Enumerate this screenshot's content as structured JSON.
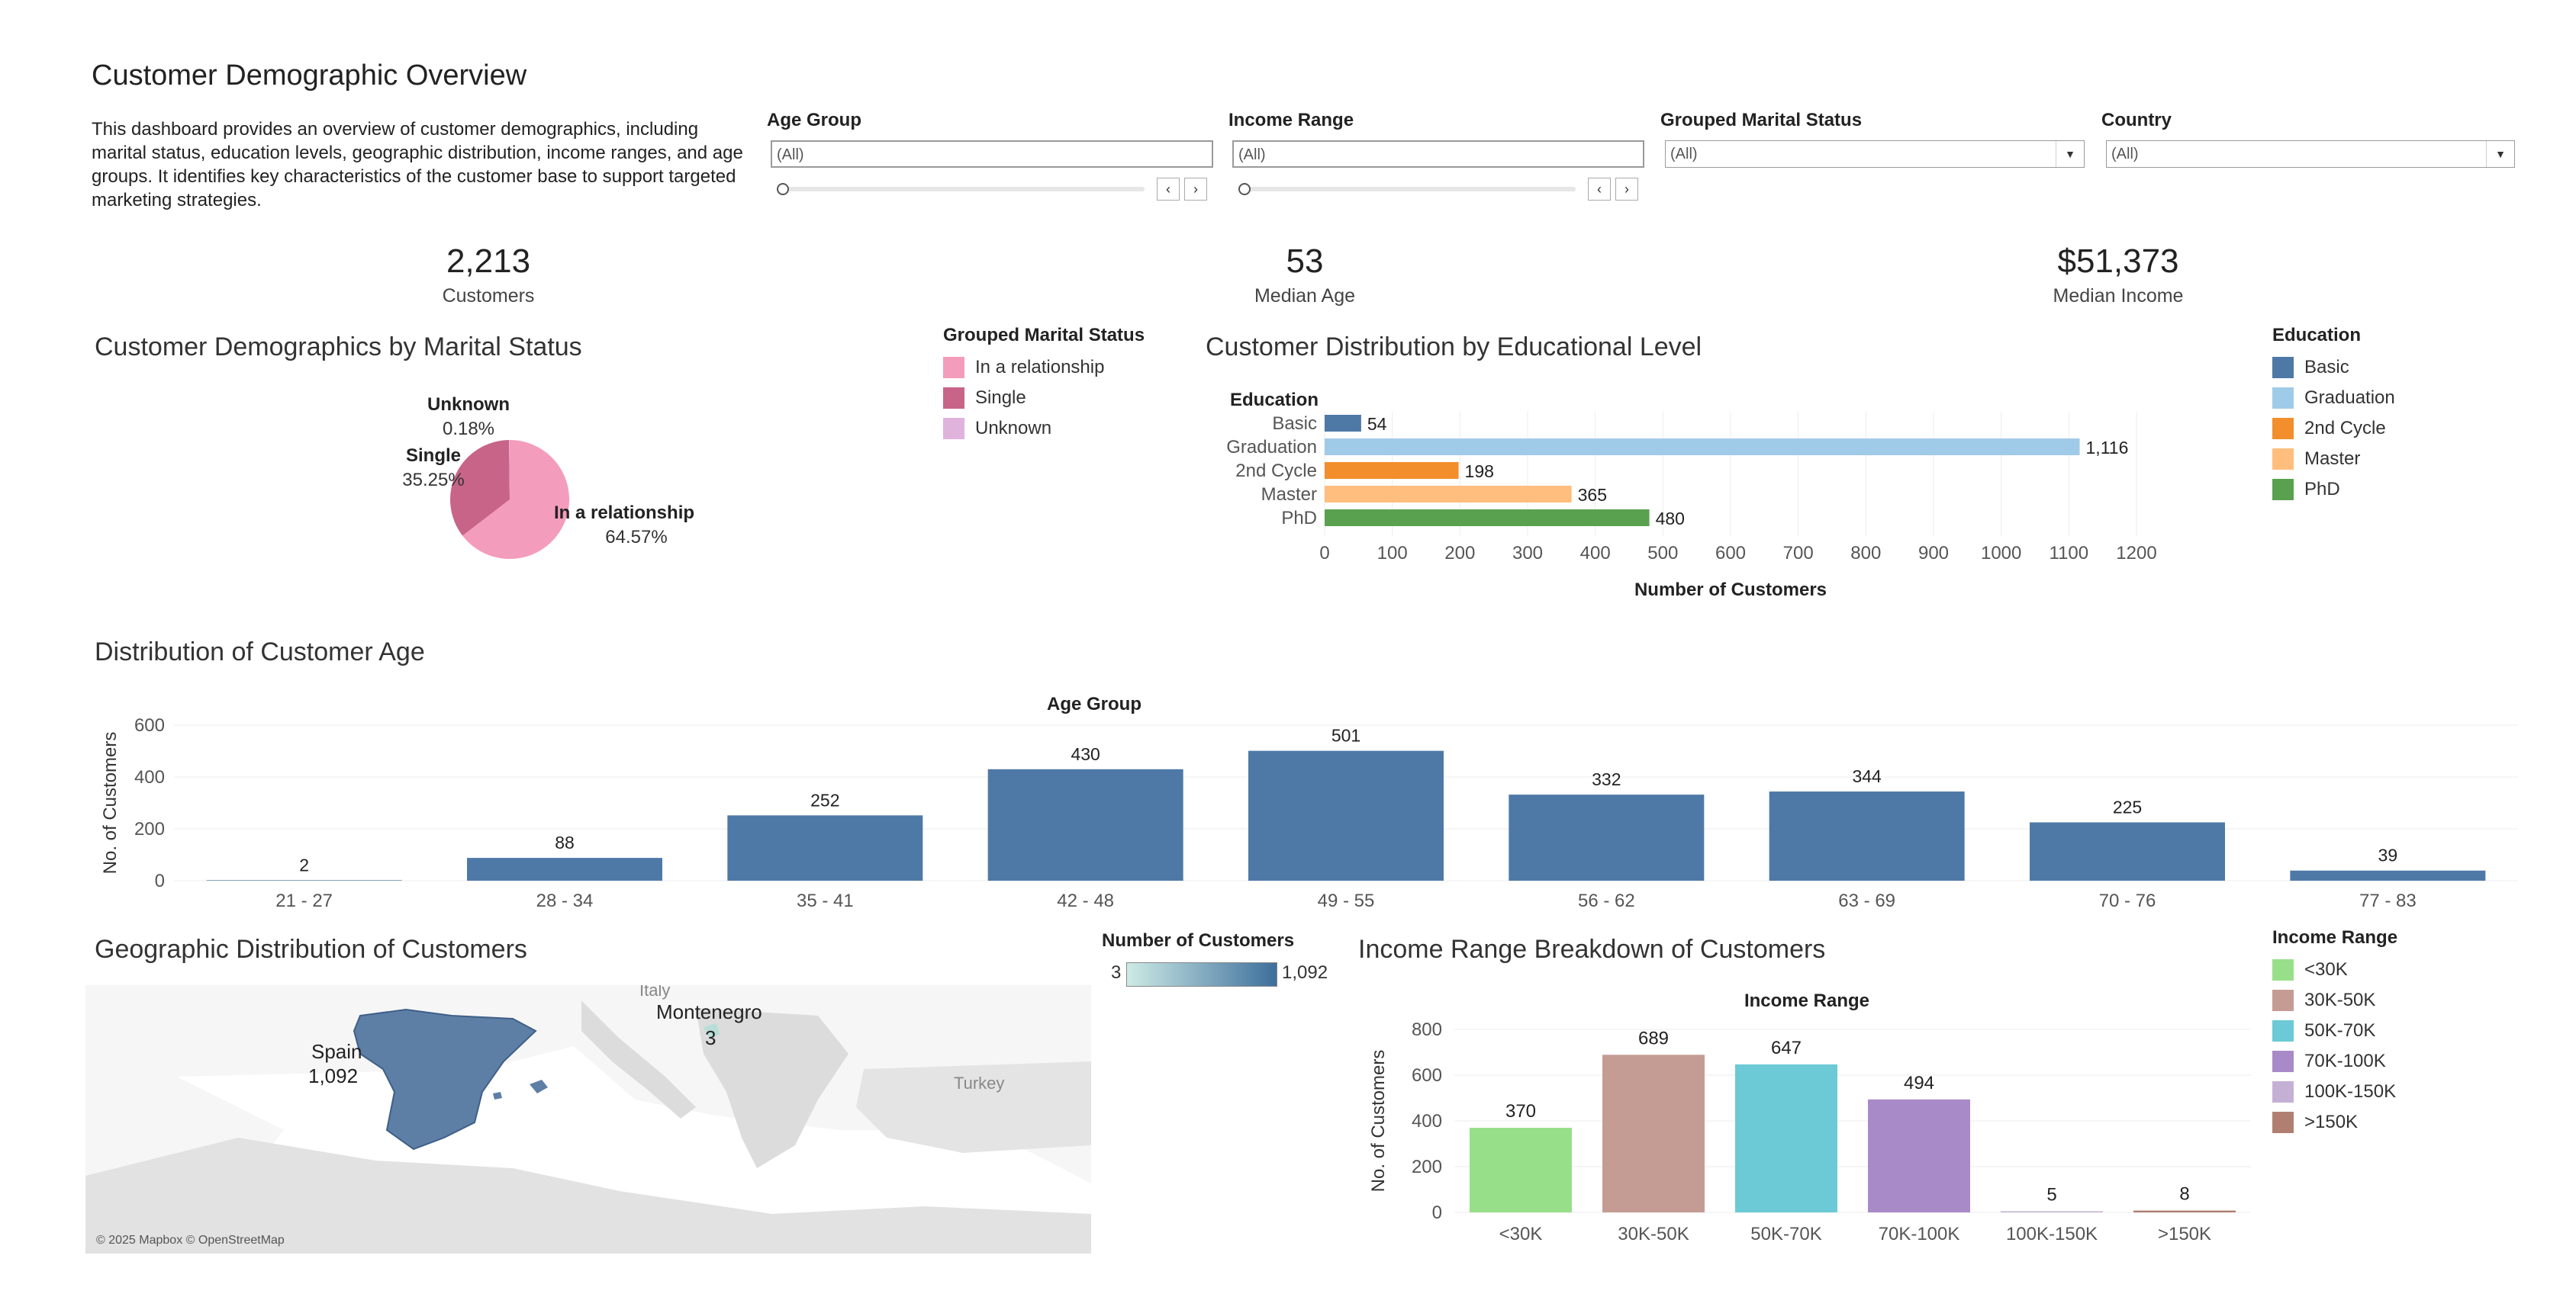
{
  "title": "Customer Demographic Overview",
  "description": "This dashboard provides an overview of customer demographics, including marital status, education levels, geographic distribution, income ranges, and age groups. It identifies key characteristics of the customer base to support targeted marketing strategies.",
  "filters": {
    "age_group": {
      "label": "Age Group",
      "value": "(All)"
    },
    "income_range": {
      "label": "Income Range",
      "value": "(All)"
    },
    "marital_status": {
      "label": "Grouped Marital Status",
      "value": "(All)"
    },
    "country": {
      "label": "Country",
      "value": "(All)"
    }
  },
  "kpis": [
    {
      "value": "2,213",
      "label": "Customers"
    },
    {
      "value": "53",
      "label": "Median Age"
    },
    {
      "value": "$51,373",
      "label": "Median Income"
    }
  ],
  "colors": {
    "steel_blue": "#4e79a7",
    "relationship": "#f49cbb",
    "single": "#c86488",
    "unknown": "#e0b3dc",
    "basic": "#4e79a7",
    "graduation": "#a0cbe8",
    "second_cycle": "#f28e2b",
    "master": "#ffbe7d",
    "phd": "#59a14f",
    "lt30k": "#98df8a",
    "k30_50": "#c49c94",
    "k50_70": "#6bcad6",
    "k70_100": "#a98ac8",
    "k100_150": "#c5b0d5",
    "gt150k": "#b07f72"
  },
  "marital": {
    "title": "Customer Demographics by Marital Status",
    "legend_title": "Grouped Marital Status",
    "legend": [
      "In a relationship",
      "Single",
      "Unknown"
    ]
  },
  "education": {
    "title": "Customer Distribution by Educational Level",
    "legend_title": "Education",
    "legend": [
      "Basic",
      "Graduation",
      "2nd Cycle",
      "Master",
      "PhD"
    ]
  },
  "age": {
    "title": "Distribution of Customer Age"
  },
  "geo": {
    "title": "Geographic Distribution of Customers",
    "legend_title": "Number of Customers",
    "legend_min": "3",
    "legend_max": "1,092",
    "labels": {
      "spain": "Spain",
      "spain_value": "1,092",
      "montenegro": "Montenegro",
      "montenegro_value": "3",
      "italy": "Italy",
      "turkey": "Turkey"
    },
    "attribution": "© 2025 Mapbox © OpenStreetMap"
  },
  "income": {
    "title": "Income Range Breakdown of Customers",
    "legend_title": "Income Range",
    "legend": [
      "<30K",
      "30K-50K",
      "50K-70K",
      "70K-100K",
      "100K-150K",
      ">150K"
    ]
  },
  "chart_data": [
    {
      "type": "pie",
      "categories": [
        "In a relationship",
        "Single",
        "Unknown"
      ],
      "values": [
        64.57,
        35.25,
        0.18
      ],
      "labels": [
        "64.57%",
        "35.25%",
        "0.18%"
      ]
    },
    {
      "type": "bar",
      "orientation": "horizontal",
      "categories": [
        "Basic",
        "Graduation",
        "2nd Cycle",
        "Master",
        "PhD"
      ],
      "values": [
        54,
        1116,
        198,
        365,
        480
      ],
      "value_labels": [
        "54",
        "1,116",
        "198",
        "365",
        "480"
      ],
      "ylabel": "Education",
      "xlabel": "Number of Customers",
      "xlim": [
        0,
        1200
      ],
      "xticks": [
        0,
        100,
        200,
        300,
        400,
        500,
        600,
        700,
        800,
        900,
        1000,
        1100,
        1200
      ]
    },
    {
      "type": "bar",
      "categories": [
        "21 - 27",
        "28 - 34",
        "35 - 41",
        "42 - 48",
        "49 - 55",
        "56 - 62",
        "63 - 69",
        "70 - 76",
        "77 - 83"
      ],
      "values": [
        2,
        88,
        252,
        430,
        501,
        332,
        344,
        225,
        39
      ],
      "title": "Age Group",
      "ylabel": "No. of Customers",
      "ylim": [
        0,
        600
      ],
      "yticks": [
        0,
        200,
        400,
        600
      ]
    },
    {
      "type": "bar",
      "categories": [
        "<30K",
        "30K-50K",
        "50K-70K",
        "70K-100K",
        "100K-150K",
        ">150K"
      ],
      "values": [
        370,
        689,
        647,
        494,
        5,
        8
      ],
      "title": "Income Range",
      "ylabel": "No. of Customers",
      "ylim": [
        0,
        800
      ],
      "yticks": [
        0,
        200,
        400,
        600,
        800
      ]
    }
  ]
}
